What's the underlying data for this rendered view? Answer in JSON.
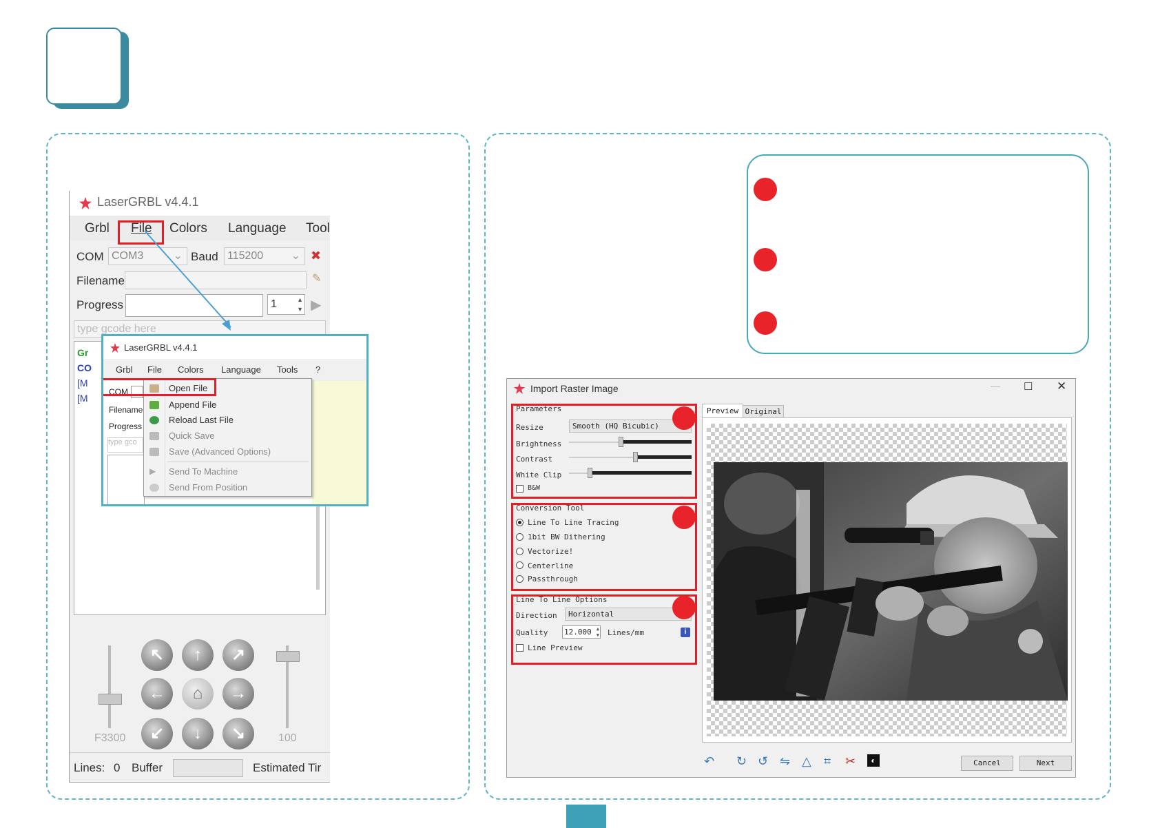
{
  "page": {
    "step_number": ""
  },
  "main_window": {
    "title": "LaserGRBL v4.4.1",
    "menu": [
      "Grbl",
      "File",
      "Colors",
      "Language",
      "Tool"
    ],
    "com_label": "COM",
    "com_value": "COM3",
    "baud_label": "Baud",
    "baud_value": "115200",
    "filename_label": "Filename",
    "progress_label": "Progress",
    "progress_value": "1",
    "gcode_placeholder": "type gcode here",
    "log_prefixes": [
      "Gr",
      "CO",
      "[M",
      "[M"
    ],
    "speed_label": "F3300",
    "step_label": "100",
    "status": {
      "lines_label": "Lines:",
      "lines_value": "0",
      "buffer_label": "Buffer",
      "estimated_label": "Estimated Tir"
    }
  },
  "file_menu_popup": {
    "title": "LaserGRBL v4.4.1",
    "menu": [
      "Grbl",
      "File",
      "Colors",
      "Language",
      "Tools",
      "?"
    ],
    "com_label": "COM",
    "filename_label": "Filename",
    "progress_label": "Progress",
    "gcode_placeholder": "type gco",
    "items": [
      {
        "label": "Open File",
        "enabled": true
      },
      {
        "label": "Append File",
        "enabled": true
      },
      {
        "label": "Reload Last File",
        "enabled": true
      },
      {
        "label": "Quick Save",
        "enabled": false
      },
      {
        "label": "Save (Advanced Options)",
        "enabled": false
      },
      {
        "label": "Send To Machine",
        "enabled": false
      },
      {
        "label": "Send From Position",
        "enabled": false
      }
    ]
  },
  "import_raster": {
    "title": "Import Raster Image",
    "parameters": {
      "title": "Parameters",
      "resize_label": "Resize",
      "resize_value": "Smooth (HQ Bicubic)",
      "brightness_label": "Brightness",
      "brightness_level": 0.42,
      "contrast_label": "Contrast",
      "contrast_level": 0.54,
      "whiteclip_label": "White Clip",
      "whiteclip_level": 0.17,
      "bw_label": "B&W"
    },
    "conversion_tool": {
      "title": "Conversion Tool",
      "options": [
        "Line To Line Tracing",
        "1bit BW Dithering",
        "Vectorize!",
        "Centerline",
        "Passthrough"
      ],
      "selected": 0
    },
    "line_options": {
      "title": "Line To Line Options",
      "direction_label": "Direction",
      "direction_value": "Horizontal",
      "quality_label": "Quality",
      "quality_value": "12.000",
      "quality_unit": "Lines/mm",
      "line_preview_label": "Line Preview"
    },
    "tabs": [
      "Preview",
      "Original"
    ],
    "buttons": {
      "cancel": "Cancel",
      "next": "Next"
    }
  },
  "colors": {
    "accent": "#3b8ba0",
    "dashed_border": "#5fb5c5",
    "highlight": "#e31e26",
    "dot": "#e8242a"
  }
}
